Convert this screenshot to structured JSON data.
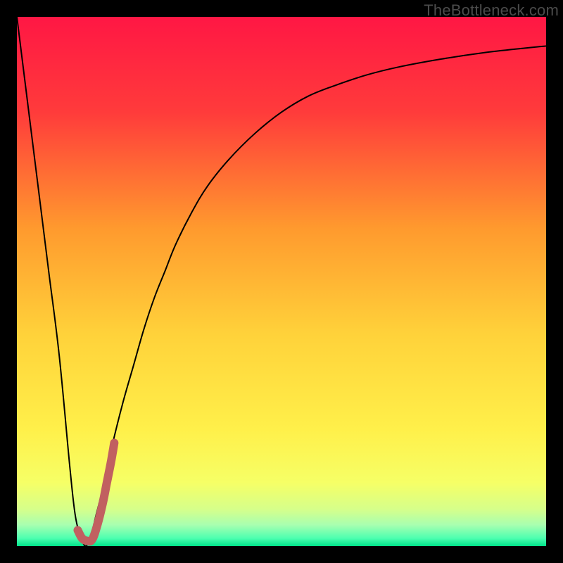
{
  "watermark": "TheBottleneck.com",
  "chart_data": {
    "type": "line",
    "title": "",
    "xlabel": "",
    "ylabel": "",
    "xlim": [
      0,
      100
    ],
    "ylim": [
      0,
      100
    ],
    "grid": false,
    "background_gradient_stops": [
      {
        "pos": 0.0,
        "color": "#ff1744"
      },
      {
        "pos": 0.18,
        "color": "#ff3b3b"
      },
      {
        "pos": 0.4,
        "color": "#ff9a2e"
      },
      {
        "pos": 0.6,
        "color": "#ffd23a"
      },
      {
        "pos": 0.78,
        "color": "#fff04a"
      },
      {
        "pos": 0.88,
        "color": "#f6ff66"
      },
      {
        "pos": 0.93,
        "color": "#d6ff8a"
      },
      {
        "pos": 0.96,
        "color": "#a8ffb0"
      },
      {
        "pos": 0.985,
        "color": "#4dffb0"
      },
      {
        "pos": 1.0,
        "color": "#00e38a"
      }
    ],
    "series": [
      {
        "name": "bottleneck-curve",
        "stroke": "#000000",
        "stroke_width": 2,
        "x": [
          0,
          2,
          4,
          6,
          8,
          10,
          11,
          12,
          13,
          14,
          15,
          16,
          18,
          20,
          22,
          24,
          26,
          28,
          30,
          33,
          36,
          40,
          45,
          50,
          55,
          60,
          66,
          72,
          80,
          88,
          96,
          100
        ],
        "y": [
          100,
          84,
          68,
          52,
          36,
          15,
          6,
          2,
          0,
          2,
          6,
          10,
          19,
          27,
          34,
          41,
          47,
          52,
          57,
          63,
          68,
          73,
          78,
          82,
          85,
          87,
          89,
          90.5,
          92,
          93.2,
          94.1,
          94.5
        ]
      },
      {
        "name": "highlight-segment",
        "stroke": "#c16060",
        "stroke_width": 12,
        "linecap": "round",
        "x": [
          11.5,
          12.3,
          13.2,
          14.2,
          15.2,
          16.2,
          17.0,
          17.8,
          18.4
        ],
        "y": [
          3.0,
          1.5,
          1.0,
          1.2,
          4.0,
          8.0,
          12.0,
          16.0,
          19.5
        ]
      }
    ]
  }
}
